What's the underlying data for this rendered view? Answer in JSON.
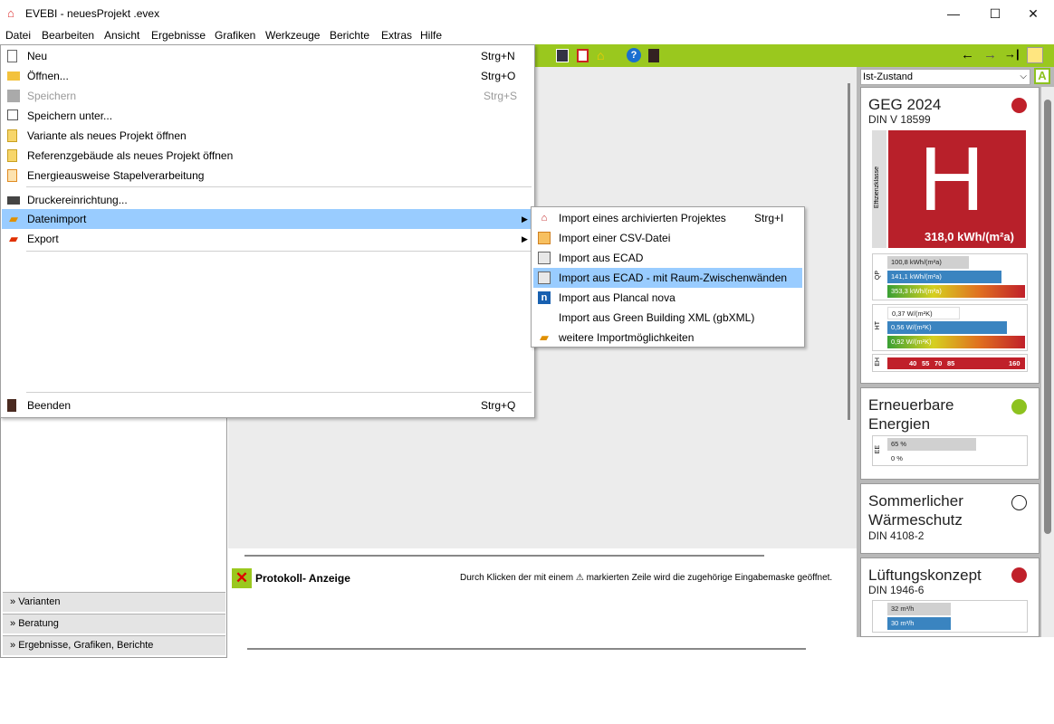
{
  "window": {
    "title": "EVEBI - neuesProjekt .evex",
    "minimize": "—",
    "maximize": "☐",
    "close": "✕"
  },
  "menubar": [
    "Datei",
    "Bearbeiten",
    "Ansicht",
    "Ergebnisse",
    "Grafiken",
    "Werkzeuge",
    "Berichte",
    "Extras",
    "Hilfe"
  ],
  "toolbar": {
    "back": "←",
    "forward": "→",
    "help": "?"
  },
  "file_menu": {
    "items": [
      {
        "label": "Neu",
        "shortcut": "Strg+N",
        "icon": "new-file-icon"
      },
      {
        "label": "Öffnen...",
        "shortcut": "Strg+O",
        "icon": "open-folder-icon"
      },
      {
        "label": "Speichern",
        "shortcut": "Strg+S",
        "icon": "save-icon",
        "disabled": true
      },
      {
        "label": "Speichern unter...",
        "shortcut": "",
        "icon": "save-as-icon"
      },
      {
        "label": "Variante als neues Projekt öffnen",
        "shortcut": "",
        "icon": "variant-icon"
      },
      {
        "label": "Referenzgebäude als neues Projekt öffnen",
        "shortcut": "",
        "icon": "reference-building-icon"
      },
      {
        "label": "Energieausweise Stapelverarbeitung",
        "shortcut": "",
        "icon": "batch-icon"
      },
      {
        "label": "Druckereinrichtung...",
        "shortcut": "",
        "icon": "printer-icon"
      },
      {
        "label": "Datenimport",
        "shortcut": "",
        "icon": "import-icon",
        "submenu": true
      },
      {
        "label": "Export",
        "shortcut": "",
        "icon": "export-icon",
        "submenu": true
      },
      {
        "label": "Beenden",
        "shortcut": "Strg+Q",
        "icon": "exit-icon"
      }
    ]
  },
  "import_submenu": {
    "items": [
      {
        "label": "Import eines archivierten Projektes",
        "shortcut": "Strg+I",
        "icon": "archive-import-icon"
      },
      {
        "label": "Import einer CSV-Datei",
        "shortcut": "",
        "icon": "csv-icon"
      },
      {
        "label": "Import aus ECAD",
        "shortcut": "",
        "icon": "ecad-icon"
      },
      {
        "label": "Import aus ECAD - mit Raum-Zwischenwänden",
        "shortcut": "",
        "icon": "ecad-walls-icon"
      },
      {
        "label": "Import aus Plancal nova",
        "shortcut": "",
        "icon": "plancal-icon"
      },
      {
        "label": "Import aus Green Building XML (gbXML)",
        "shortcut": "",
        "icon": ""
      },
      {
        "label": "weitere Importmöglichkeiten",
        "shortcut": "",
        "icon": "more-import-icon"
      }
    ]
  },
  "left_nav": [
    "Varianten",
    "Beratung",
    "Ergebnisse, Grafiken, Berichte"
  ],
  "protocol": {
    "title": "Protokoll- Anzeige",
    "hint": "Durch Klicken der mit einem ⚠ markierten Zeile wird die zugehörige Eingabemaske geöffnet."
  },
  "right_panel": {
    "state_select": "Ist-Zustand",
    "geg": {
      "title": "GEG 2024",
      "subtitle": "DIN V 18599",
      "class_letter": "H",
      "class_axis_label": "Effizienzklasse",
      "value": "318,0 kWh/(m²a)",
      "status_color": "#c0202a",
      "qp_label": "QP",
      "qp": [
        "100,8 kWh/(m²a)",
        "141,1 kWh/(m²a)",
        "353,3 kWh/(m²a)"
      ],
      "ht_label": "HT",
      "ht": [
        "0,37 W/(m²K)",
        "0,56 W/(m²K)",
        "0,92 W/(m²K)"
      ],
      "eh_label": "EH",
      "eh_ticks": [
        "40",
        "55",
        "70",
        "85",
        "160"
      ]
    },
    "ee": {
      "title1": "Erneuerbare",
      "title2": "Energien",
      "label": "EE",
      "values": [
        "65 %",
        "0 %"
      ],
      "status_color": "#8dc21f"
    },
    "summer": {
      "title1": "Sommerlicher",
      "title2": "Wärmeschutz",
      "subtitle": "DIN 4108-2"
    },
    "vent": {
      "title": "Lüftungskonzept",
      "subtitle": "DIN 1946-6",
      "values": [
        "32 m³/h",
        "30 m³/h"
      ],
      "status_color": "#c0202a"
    }
  }
}
